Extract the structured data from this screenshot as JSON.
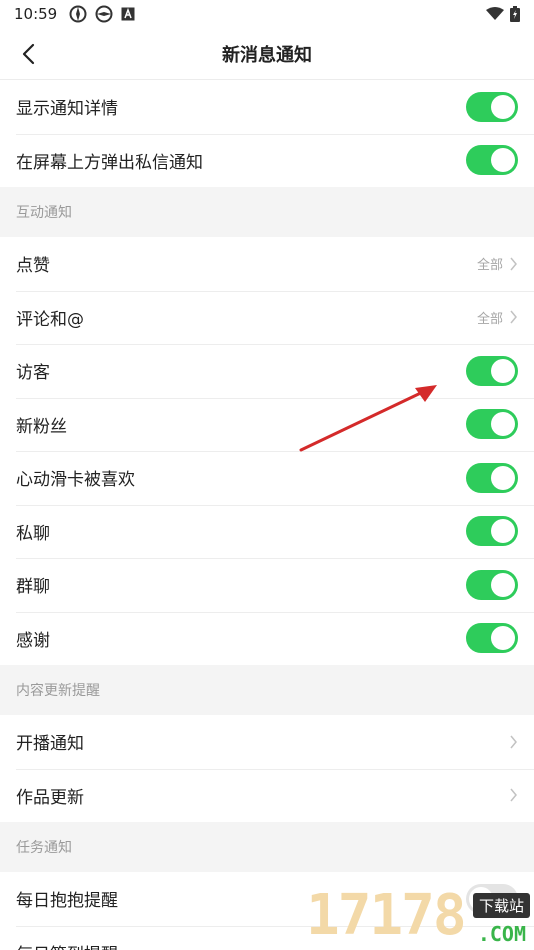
{
  "status_bar": {
    "time": "10:59"
  },
  "nav": {
    "title": "新消息通知"
  },
  "general": [
    {
      "label": "显示通知详情",
      "toggle": true
    },
    {
      "label": "在屏幕上方弹出私信通知",
      "toggle": true
    }
  ],
  "interaction": {
    "header": "互动通知",
    "items": [
      {
        "label": "点赞",
        "value": "全部"
      },
      {
        "label": "评论和@",
        "value": "全部"
      },
      {
        "label": "访客",
        "toggle": true
      },
      {
        "label": "新粉丝",
        "toggle": true
      },
      {
        "label": "心动滑卡被喜欢",
        "toggle": true
      },
      {
        "label": "私聊",
        "toggle": true
      },
      {
        "label": "群聊",
        "toggle": true
      },
      {
        "label": "感谢",
        "toggle": true
      }
    ]
  },
  "content_updates": {
    "header": "内容更新提醒",
    "items": [
      {
        "label": "开播通知"
      },
      {
        "label": "作品更新"
      }
    ]
  },
  "tasks": {
    "header": "任务通知",
    "items": [
      {
        "label": "每日抱抱提醒",
        "toggle": false
      },
      {
        "label": "每日签到提醒"
      }
    ]
  },
  "watermark": {
    "digits": "17178",
    "tag": "下载站",
    "suffix": ".COM"
  },
  "colors": {
    "toggle_on": "#2ecc5b",
    "annotation_arrow": "#d42a2a"
  }
}
